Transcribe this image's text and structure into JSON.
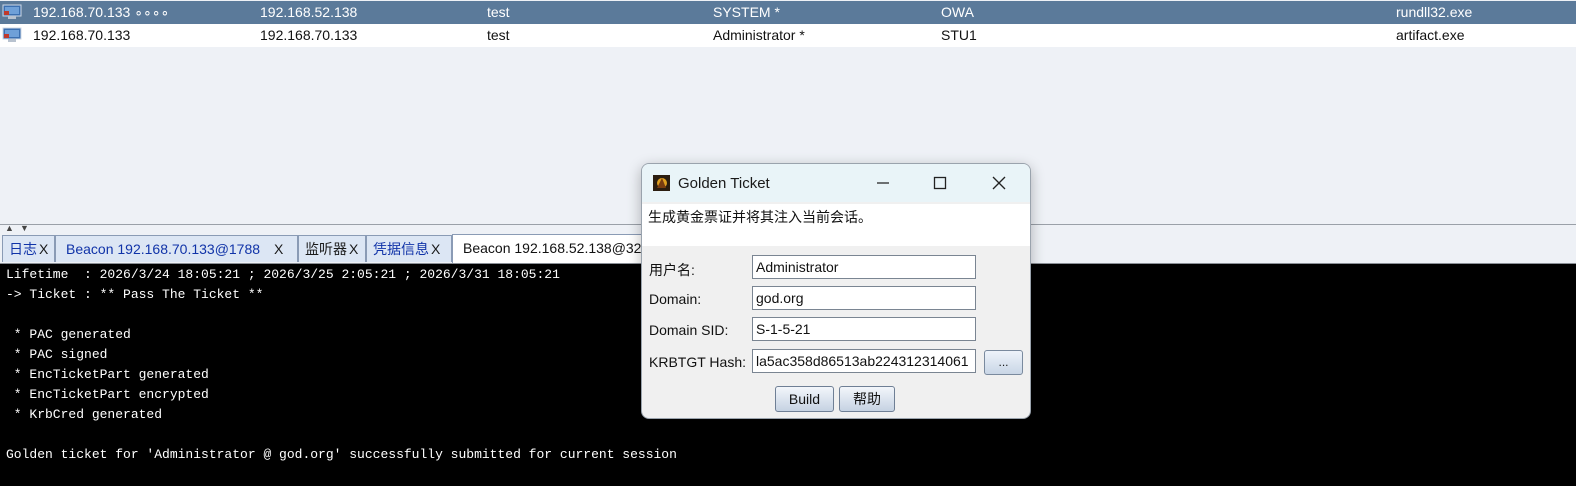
{
  "beacons": [
    {
      "external": "192.168.70.133 ∘∘∘∘",
      "internal": "192.168.52.138",
      "listener": "test",
      "user": "SYSTEM *",
      "computer": "OWA",
      "process": "rundll32.exe",
      "selected": true
    },
    {
      "external": "192.168.70.133",
      "internal": "192.168.70.133",
      "listener": "test",
      "user": "Administrator *",
      "computer": "STU1",
      "process": "artifact.exe",
      "selected": false
    }
  ],
  "tabs": [
    {
      "label": "日志",
      "close": "X"
    },
    {
      "label": "Beacon 192.168.70.133@1788",
      "close": "X"
    },
    {
      "label": "监听器",
      "close": "X"
    },
    {
      "label": "凭据信息",
      "close": "X"
    },
    {
      "label": "Beacon 192.168.52.138@32",
      "close": ""
    }
  ],
  "console": {
    "lines": [
      "Lifetime  : 2026/3/24 18:05:21 ; 2026/3/25 2:05:21 ; 2026/3/31 18:05:21",
      "-> Ticket : ** Pass The Ticket **",
      "",
      " * PAC generated",
      " * PAC signed",
      " * EncTicketPart generated",
      " * EncTicketPart encrypted",
      " * KrbCred generated",
      "",
      "Golden ticket for 'Administrator @ god.org' successfully submitted for current session"
    ]
  },
  "dialog": {
    "title": "Golden Ticket",
    "description": "生成黄金票证并将其注入当前会话。",
    "fields": {
      "user_label": "用户名:",
      "user_value": "Administrator",
      "domain_label": "Domain:",
      "domain_value": "god.org",
      "sid_label": "Domain SID:",
      "sid_value": "S-1-5-21",
      "hash_label": "KRBTGT Hash:",
      "hash_value": "la5ac358d86513ab224312314061"
    },
    "browse_label": "...",
    "build_label": "Build",
    "help_label": "帮助"
  },
  "colors": {
    "selected_row": "#5b7a9a",
    "console_bg": "#000000",
    "tab_text": "#1033a8"
  },
  "icons": {
    "row_icon": "monitor-icon",
    "app_icon": "cobalt-strike-icon"
  }
}
